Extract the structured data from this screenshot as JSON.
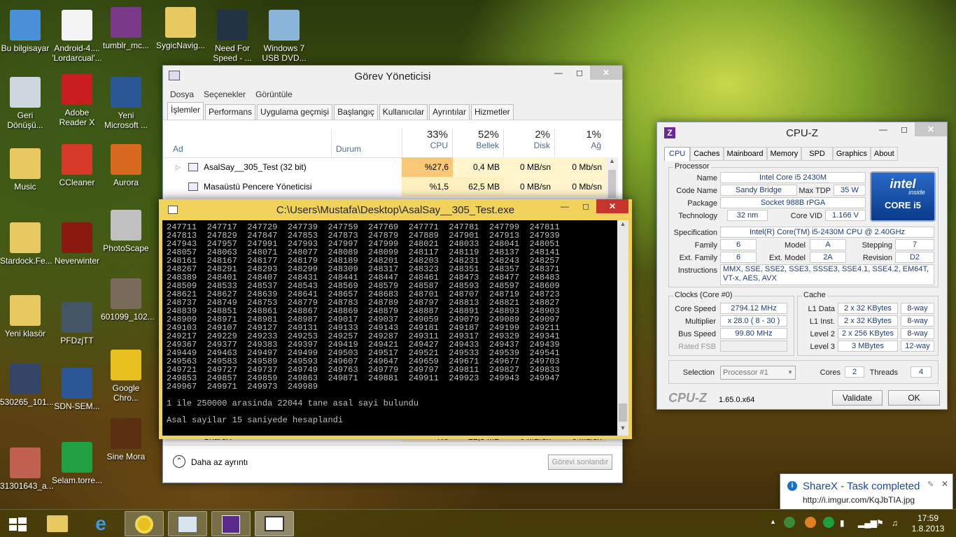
{
  "desktop_icons": [
    {
      "label": "Bu bilgisayar",
      "color": "#4a90d9"
    },
    {
      "label": "Android-4.... 'Lordarcual'...",
      "color": "#f4f4f4"
    },
    {
      "label": "tumblr_mc...",
      "color": "#7a3a8a"
    },
    {
      "label": "SygicNavig...",
      "color": "#e8c860"
    },
    {
      "label": "Need For Speed - ...",
      "color": "#223344"
    },
    {
      "label": "Windows 7 USB DVD...",
      "color": "#8ab4d8"
    },
    {
      "label": "Geri Dönüşü...",
      "color": "#cfd8e0"
    },
    {
      "label": "Adobe Reader X",
      "color": "#c81e1e"
    },
    {
      "label": "Yeni Microsoft ...",
      "color": "#2b5797"
    },
    {
      "label": "Music",
      "color": "#e8c860"
    },
    {
      "label": "CCleaner",
      "color": "#d83a2a"
    },
    {
      "label": "Aurora",
      "color": "#d86a20"
    },
    {
      "label": "Stardock.Fe...",
      "color": "#e8c860"
    },
    {
      "label": "Neverwinter",
      "color": "#8a1a10"
    },
    {
      "label": "PhotoScape",
      "color": "#c0c0c0"
    },
    {
      "label": "601099_102...",
      "color": "#7a6a5a"
    },
    {
      "label": "Yeni klasör",
      "color": "#e8c860"
    },
    {
      "label": "PFDzjTT",
      "color": "#445566"
    },
    {
      "label": "530265_101...",
      "color": "#334466"
    },
    {
      "label": "SDN-SEM...",
      "color": "#2b5797"
    },
    {
      "label": "Google Chro...",
      "color": "#e8c020"
    },
    {
      "label": "Sine Mora",
      "color": "#5a3010"
    },
    {
      "label": "31301643_a...",
      "color": "#c06050"
    },
    {
      "label": "Selam.torre...",
      "color": "#20a040"
    }
  ],
  "task_manager": {
    "title": "Görev Yöneticisi",
    "menu": [
      "Dosya",
      "Seçenekler",
      "Görüntüle"
    ],
    "tabs": [
      "İşlemler",
      "Performans",
      "Uygulama geçmişi",
      "Başlangıç",
      "Kullanıcılar",
      "Ayrıntılar",
      "Hizmetler"
    ],
    "columns": {
      "name": "Ad",
      "status": "Durum",
      "cpu_pct": "33%",
      "cpu": "CPU",
      "mem_pct": "52%",
      "mem": "Bellek",
      "disk_pct": "2%",
      "disk": "Disk",
      "net_pct": "1%",
      "net": "Ağ"
    },
    "rows": [
      {
        "name": "AsalSay__305_Test (32 bit)",
        "cpu": "%27,6",
        "mem": "0,4 MB",
        "disk": "0 MB/sn",
        "net": "0 Mb/sn"
      },
      {
        "name": "Masaüstü Pencere Yöneticisi",
        "cpu": "%1,5",
        "mem": "62,5 MB",
        "disk": "0 MB/sn",
        "net": "0 Mb/sn"
      },
      {
        "name": "ShareX",
        "cpu": "%0",
        "mem": "22,5 MB",
        "disk": "0 MB/sn",
        "net": "0 Mb/sn"
      }
    ],
    "fewer_details": "Daha az ayrıntı",
    "end_task": "Görevi sonlandır"
  },
  "console": {
    "title": "C:\\Users\\Mustafa\\Desktop\\AsalSay__305_Test.exe",
    "lines": [
      "247711  247717  247729  247739  247759  247769  247771  247781  247799  247811",
      "247813  247829  247847  247853  247873  247879  247889  247901  247913  247939",
      "247943  247957  247991  247993  247997  247999  248021  248033  248041  248051",
      "248057  248063  248071  248077  248089  248099  248117  248119  248137  248141",
      "248161  248167  248177  248179  248189  248201  248203  248231  248243  248257",
      "248267  248291  248293  248299  248309  248317  248323  248351  248357  248371",
      "248389  248401  248407  248431  248441  248447  248461  248473  248477  248483",
      "248509  248533  248537  248543  248569  248579  248587  248593  248597  248609",
      "248621  248627  248639  248641  248657  248683  248701  248707  248719  248723",
      "248737  248749  248753  248779  248783  248789  248797  248813  248821  248827",
      "248839  248851  248861  248867  248869  248879  248887  248891  248893  248903",
      "248909  248971  248981  248987  249017  249037  249059  249079  249089  249097",
      "249103  249107  249127  249131  249133  249143  249181  249187  249199  249211",
      "249217  249229  249233  249253  249257  249287  249311  249317  249329  249341",
      "249367  249377  249383  249397  249419  249421  249427  249433  249437  249439",
      "249449  249463  249497  249499  249503  249517  249521  249533  249539  249541",
      "249563  249583  249589  249593  249607  249647  249659  249671  249677  249703",
      "249721  249727  249737  249749  249763  249779  249797  249811  249827  249833",
      "249853  249857  249859  249863  249871  249881  249911  249923  249943  249947",
      "249967  249971  249973  249989",
      "",
      "1 ile 250000 arasinda 22044 tane asal sayi bulundu",
      "",
      "Asal sayilar 15 saniyede hesaplandi"
    ]
  },
  "cpuz": {
    "title": "CPU-Z",
    "tabs": [
      "CPU",
      "Caches",
      "Mainboard",
      "Memory",
      "SPD",
      "Graphics",
      "About"
    ],
    "processor_legend": "Processor",
    "name_lbl": "Name",
    "name": "Intel Core i5 2430M",
    "codename_lbl": "Code Name",
    "codename": "Sandy Bridge",
    "maxtdp_lbl": "Max TDP",
    "maxtdp": "35 W",
    "package_lbl": "Package",
    "package": "Socket 988B rPGA",
    "tech_lbl": "Technology",
    "tech": "32 nm",
    "corevid_lbl": "Core VID",
    "corevid": "1.166 V",
    "spec_lbl": "Specification",
    "spec": "Intel(R) Core(TM) i5-2430M CPU @ 2.40GHz",
    "family_lbl": "Family",
    "family": "6",
    "model_lbl": "Model",
    "model": "A",
    "stepping_lbl": "Stepping",
    "stepping": "7",
    "extfamily_lbl": "Ext. Family",
    "extfamily": "6",
    "extmodel_lbl": "Ext. Model",
    "extmodel": "2A",
    "revision_lbl": "Revision",
    "revision": "D2",
    "instr_lbl": "Instructions",
    "instr": "MMX, SSE, SSE2, SSE3, SSSE3, SSE4.1, SSE4.2, EM64T, VT-x, AES, AVX",
    "intel_logo": "intel",
    "intel_inside": "inside",
    "intel_core": "CORE i5",
    "clocks_legend": "Clocks (Core #0)",
    "corespeed_lbl": "Core Speed",
    "corespeed": "2794.12 MHz",
    "mult_lbl": "Multiplier",
    "mult": "x 28.0 ( 8 - 30 )",
    "bus_lbl": "Bus Speed",
    "bus": "99.80 MHz",
    "fsb_lbl": "Rated FSB",
    "fsb": "",
    "cache_legend": "Cache",
    "l1d_lbl": "L1 Data",
    "l1d": "2 x 32 KBytes",
    "l1d_w": "8-way",
    "l1i_lbl": "L1 Inst.",
    "l1i": "2 x 32 KBytes",
    "l1i_w": "8-way",
    "l2_lbl": "Level 2",
    "l2": "2 x 256 KBytes",
    "l2_w": "8-way",
    "l3_lbl": "Level 3",
    "l3": "3 MBytes",
    "l3_w": "12-way",
    "selection_lbl": "Selection",
    "selection": "Processor #1",
    "cores_lbl": "Cores",
    "cores": "2",
    "threads_lbl": "Threads",
    "threads": "4",
    "brand": "CPU-Z",
    "version": "1.65.0.x64",
    "validate": "Validate",
    "ok": "OK"
  },
  "toast": {
    "title": "ShareX - Task completed",
    "url": "http://i.imgur.com/KqJbTIA.jpg"
  },
  "taskbar": {
    "time": "17:59",
    "date": "1.8.2013"
  }
}
